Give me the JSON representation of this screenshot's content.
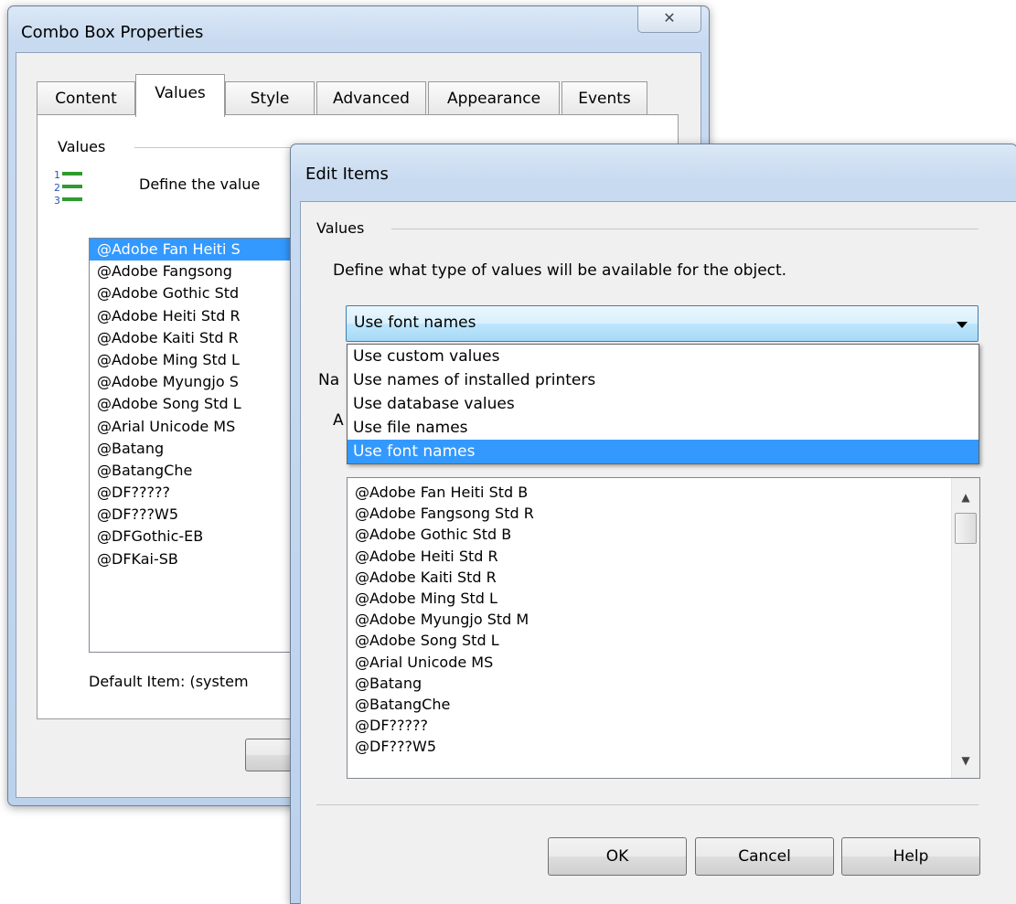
{
  "background_dialog": {
    "title": "Combo Box Properties",
    "close_icon": "✕",
    "tabs": [
      {
        "label": "Content"
      },
      {
        "label": "Values"
      },
      {
        "label": "Style"
      },
      {
        "label": "Advanced"
      },
      {
        "label": "Appearance"
      },
      {
        "label": "Events"
      }
    ],
    "active_tab": "Values",
    "group_label": "Values",
    "description": "Define the value",
    "list_items": [
      "@Adobe Fan Heiti S",
      "@Adobe Fangsong",
      "@Adobe Gothic Std",
      "@Adobe Heiti Std R",
      "@Adobe Kaiti Std R",
      "@Adobe Ming Std L",
      "@Adobe Myungjo S",
      "@Adobe Song Std L",
      "@Arial Unicode MS",
      "@Batang",
      "@BatangChe",
      "@DF?????",
      "@DF???W5",
      "@DFGothic-EB",
      "@DFKai-SB"
    ],
    "default_item": "Default Item: (system",
    "icon": "numbered-list-icon"
  },
  "edit_items": {
    "title": "Edit Items",
    "group_label": "Values",
    "description": "Define what type of values will be available for the object.",
    "combo_value": "Use font names",
    "dropdown_options": [
      "Use custom values",
      "Use names of installed printers",
      "Use database values",
      "Use file names",
      "Use font names"
    ],
    "selected_option": "Use font names",
    "partial_label_1": "Na",
    "partial_label_2": "A",
    "font_list": [
      "@Adobe Fan Heiti Std B",
      "@Adobe Fangsong Std R",
      "@Adobe Gothic Std B",
      "@Adobe Heiti Std R",
      "@Adobe Kaiti Std R",
      "@Adobe Ming Std L",
      "@Adobe Myungjo Std M",
      "@Adobe Song Std L",
      "@Arial Unicode MS",
      "@Batang",
      "@BatangChe",
      "@DF?????",
      "@DF???W5"
    ],
    "buttons": {
      "ok": "OK",
      "cancel": "Cancel",
      "help": "Help"
    }
  }
}
